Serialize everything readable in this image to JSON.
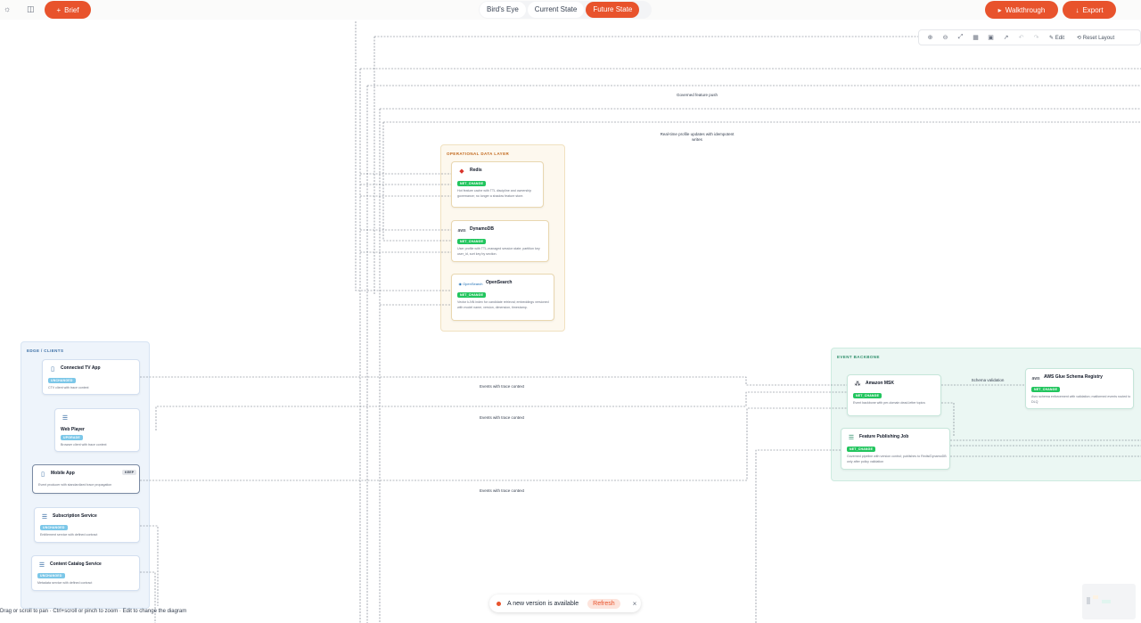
{
  "header": {
    "brief_label": "Brief",
    "tabs": [
      {
        "label": "Bird's Eye",
        "active": false
      },
      {
        "label": "Current State",
        "active": false
      },
      {
        "label": "Future State",
        "active": true
      }
    ],
    "walkthrough_label": "Walkthrough",
    "export_label": "Export"
  },
  "toolbar": {
    "edit_label": "Edit",
    "reset_label": "Reset Layout"
  },
  "edge_labels": {
    "governed_push": "Governed feature push",
    "realtime_updates": "Real-time profile updates with idempotent writes",
    "events_trace_1": "Events with trace context",
    "events_trace_2": "Events with trace context",
    "events_trace_3": "Events with trace context",
    "schema_validation": "Schema validation"
  },
  "groups": {
    "operational": "OPERATIONAL DATA LAYER",
    "edge": "EDGE / CLIENTS",
    "backbone": "EVENT BACKBONE"
  },
  "nodes": {
    "redis": {
      "title": "Redis",
      "badge": "NET_CHANGE",
      "desc": "Hot feature cache with TTL discipline and ownership governance; no longer a shadow feature store."
    },
    "dynamodb": {
      "title": "DynamoDB",
      "badge": "NET_CHANGE",
      "desc": "User profile with TTL-managed session state; partition key user_id, sort key by section."
    },
    "opensearch": {
      "title": "OpenSearch",
      "badge": "NET_CHANGE",
      "desc": "Vector k-NN index for candidate retrieval; embeddings versioned with model name, version, dimension, timestamp."
    },
    "ctv": {
      "title": "Connected TV App",
      "badge": "UNCHANGED",
      "desc": "CTV client with trace context"
    },
    "web": {
      "title": "Web Player",
      "badge": "UPGRADE",
      "desc": "Browser client with trace context"
    },
    "mobile": {
      "title": "Mobile App",
      "badge": "KEEP",
      "desc": "Event producer with standardized trace propagation"
    },
    "subscription": {
      "title": "Subscription Service",
      "badge": "UNCHANGED",
      "desc": "Entitlement service with defined contract"
    },
    "catalog": {
      "title": "Content Catalog Service",
      "badge": "UNCHANGED",
      "desc": "Metadata service with defined contract"
    },
    "msk": {
      "title": "Amazon MSK",
      "badge": "NET_CHANGE",
      "desc": "Event backbone with per-domain dead-letter topics"
    },
    "schema_registry": {
      "title": "AWS Glue Schema Registry",
      "badge": "NET_CHANGE",
      "desc": "Avro schema enforcement with validation; malformed events routed to DLQ"
    },
    "feature_job": {
      "title": "Feature Publishing Job",
      "badge": "NET_CHANGE",
      "desc": "Governed pipeline with version control; publishes to Redis/DynamoDB only after policy validation"
    }
  },
  "footer": {
    "hint": "Drag or scroll to pan · Ctrl+scroll or pinch to zoom · Edit to change the diagram"
  },
  "toast": {
    "message": "A new version is available",
    "refresh_label": "Refresh",
    "close_glyph": "×"
  },
  "colors": {
    "accent": "#e8532c",
    "badge_green": "#22c55e",
    "badge_blue": "#7cc7e8",
    "operational_bg": "#fdf8ee",
    "edge_bg": "#eef4fb",
    "backbone_bg": "#ebf7f3"
  }
}
